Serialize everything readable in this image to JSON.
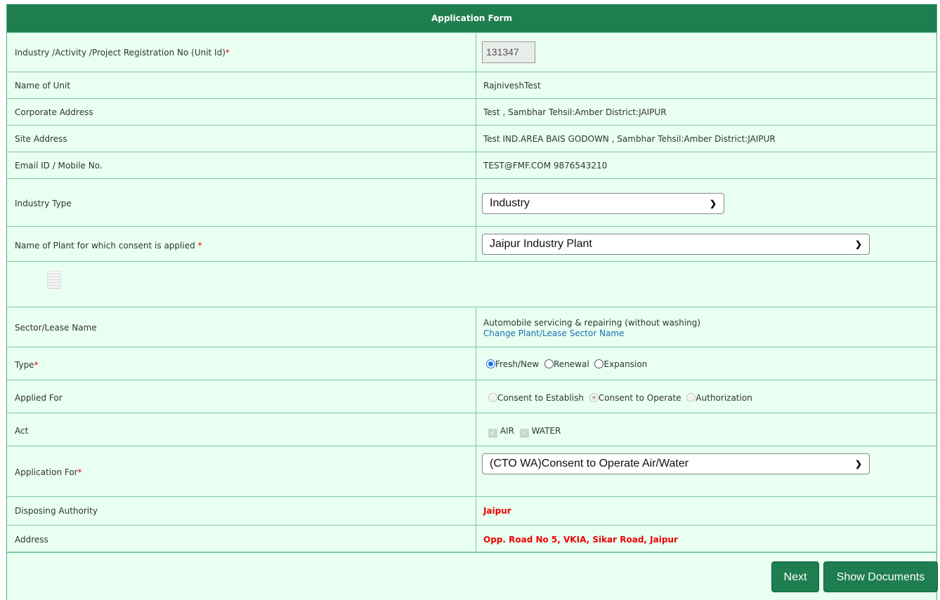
{
  "form": {
    "title": "Application Form",
    "rows": {
      "unit_id": {
        "label": "Industry /Activity /Project Registration No (Unit Id)",
        "req": "*",
        "value": "131347"
      },
      "name_of_unit": {
        "label": "Name of Unit",
        "value": "RajniveshTest"
      },
      "corporate_address": {
        "label": "Corporate Address",
        "value": "Test , Sambhar Tehsil:Amber District:JAIPUR"
      },
      "site_address": {
        "label": "Site Address",
        "value": "Test IND.AREA BAIS GODOWN , Sambhar Tehsil:Amber District:JAIPUR"
      },
      "email_mobile": {
        "label": "Email ID / Mobile No.",
        "value": "TEST@FMF.COM 9876543210"
      },
      "industry_type": {
        "label": "Industry Type",
        "selected": "Industry"
      },
      "plant_name": {
        "label": "Name of Plant for which consent is applied",
        "req": "*",
        "selected": "Jaipur Industry Plant"
      },
      "sector": {
        "label": "Sector/Lease Name",
        "value": "Automobile servicing & repairing (without washing)",
        "link": "Change Plant/Lease Sector Name"
      },
      "type": {
        "label": "Type",
        "req": "*",
        "options": [
          "Fresh/New",
          "Renewal",
          "Expansion"
        ],
        "selected": "Fresh/New"
      },
      "applied_for": {
        "label": "Applied For",
        "options": [
          "Consent to Establish",
          "Consent to Operate",
          "Authorization"
        ],
        "selected": "Consent to Operate"
      },
      "act": {
        "label": "Act",
        "options": [
          "AIR",
          "WATER"
        ]
      },
      "application_for": {
        "label": "Application For",
        "req": "*",
        "selected": "(CTO WA)Consent to Operate Air/Water"
      },
      "disposing_authority": {
        "label": "Disposing Authority",
        "value": "Jaipur"
      },
      "address": {
        "label": "Address",
        "value": "Opp. Road No 5, VKIA, Sikar Road, Jaipur"
      }
    },
    "buttons": {
      "next": "Next",
      "show_documents": "Show Documents"
    }
  },
  "colors": {
    "header": "#1e7e4f",
    "background": "#e8fff1",
    "required": "#ee0000",
    "link": "#1a6fb0"
  }
}
